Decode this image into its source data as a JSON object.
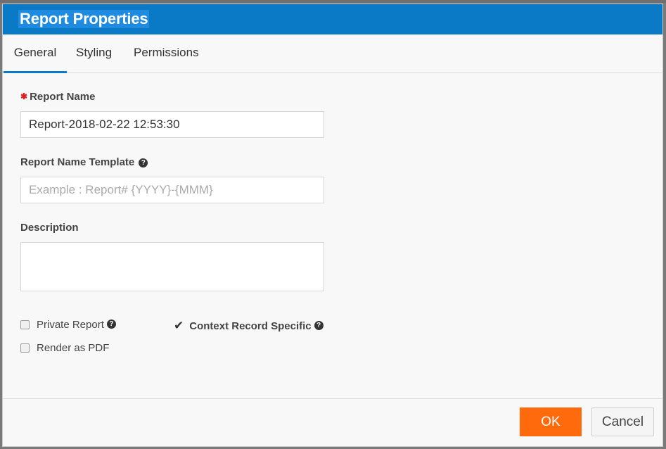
{
  "dialog": {
    "title": "Report Properties"
  },
  "tabs": [
    {
      "label": "General",
      "active": true
    },
    {
      "label": "Styling",
      "active": false
    },
    {
      "label": "Permissions",
      "active": false
    }
  ],
  "form": {
    "report_name": {
      "label": "Report Name",
      "required": true,
      "value": "Report-2018-02-22 12:53:30"
    },
    "report_name_template": {
      "label": "Report Name Template",
      "placeholder": "Example : Report# {YYYY}-{MMM}",
      "value": ""
    },
    "description": {
      "label": "Description",
      "value": ""
    },
    "private_report": {
      "label": "Private Report",
      "checked": false
    },
    "render_as_pdf": {
      "label": "Render as PDF",
      "checked": false
    },
    "context_record_specific": {
      "label": "Context Record Specific",
      "checked": true
    }
  },
  "buttons": {
    "ok": "OK",
    "cancel": "Cancel"
  },
  "icons": {
    "help": "?",
    "required": "✱",
    "checkmark": "✔"
  },
  "colors": {
    "title_bar": "#0a79c6",
    "ok_button": "#ff6a0d",
    "active_tab_underline": "#0a79c6",
    "required_star": "#e02020"
  }
}
